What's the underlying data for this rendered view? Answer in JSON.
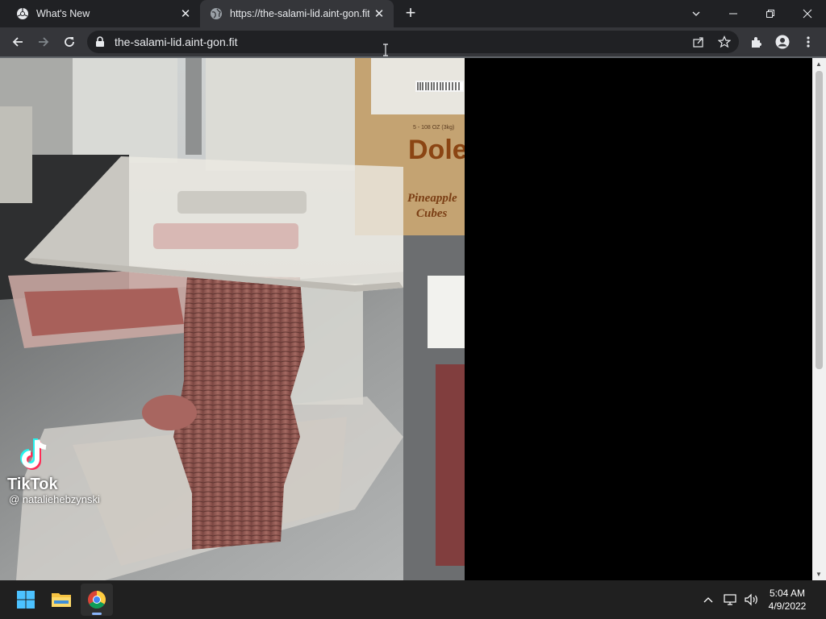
{
  "browser": {
    "tabs": [
      {
        "title": "What's New",
        "active": false
      },
      {
        "title": "https://the-salami-lid.aint-gon.fit",
        "active": true
      }
    ],
    "address": "the-salami-lid.aint-gon.fit"
  },
  "video": {
    "watermark_brand": "TikTok",
    "watermark_user": "@ nataliehebzynski",
    "box_brand": "Dole",
    "box_label_line1": "Pineapple",
    "box_label_line2": "Cubes",
    "box_small": "5 - 108 OZ (3kg)"
  },
  "taskbar": {
    "time": "5:04 AM",
    "date": "4/9/2022"
  },
  "colors": {
    "titlebar": "#202124",
    "toolbar": "#35363a",
    "taskbar": "#202020",
    "accent": "#8ab4f8"
  }
}
